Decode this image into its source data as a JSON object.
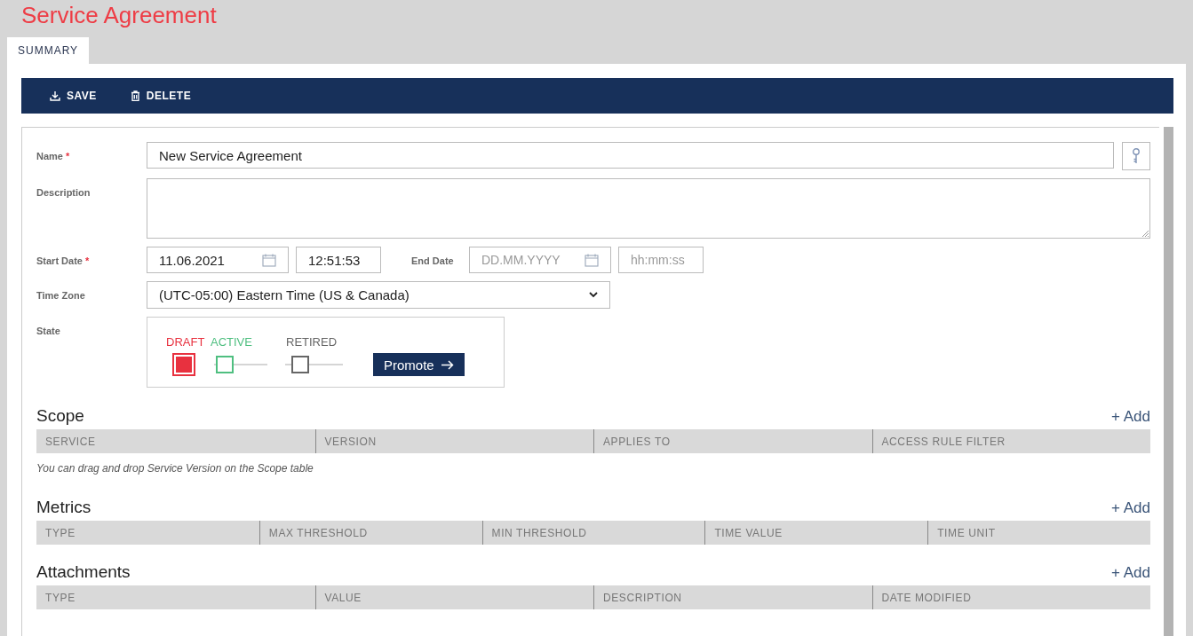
{
  "page_title": "Service Agreement",
  "tabs": [
    {
      "label": "SUMMARY",
      "selected": true
    }
  ],
  "toolbar": [
    {
      "kind": "save",
      "label": "SAVE"
    },
    {
      "kind": "delete",
      "label": "DELETE"
    }
  ],
  "form": {
    "name": {
      "label": "Name",
      "required_mark": "*",
      "value": "New Service Agreement"
    },
    "description": {
      "label": "Description"
    },
    "start": {
      "label": "Start Date",
      "required_mark": "*",
      "date": "11.06.2021",
      "time": "12:51:53"
    },
    "end": {
      "label": "End Date",
      "date_placeholder": "DD.MM.YYYY",
      "time_placeholder": "hh:mm:ss"
    },
    "time_zone": {
      "label": "Time Zone",
      "value": "(UTC-05:00) Eastern Time (US & Canada)"
    },
    "state": {
      "label": "State",
      "stages": [
        {
          "label": "DRAFT",
          "color": "#e8313f",
          "selected": true
        },
        {
          "label": "ACTIVE",
          "color": "#4fbf80",
          "selected": false
        },
        {
          "label": "RETIRED",
          "color": "#666666",
          "selected": false
        }
      ],
      "button": "Promote"
    }
  },
  "sections": [
    {
      "title": "Scope",
      "add": "+ Add",
      "columns": [
        "SERVICE",
        "VERSION",
        "APPLIES TO",
        "ACCESS RULE FILTER"
      ],
      "note": "You can drag and drop Service Version on the Scope table"
    },
    {
      "title": "Metrics",
      "add": "+ Add",
      "columns": [
        "TYPE",
        "MAX THRESHOLD",
        "MIN THRESHOLD",
        "TIME VALUE",
        "TIME UNIT"
      ]
    },
    {
      "title": "Attachments",
      "add": "+ Add",
      "columns": [
        "TYPE",
        "VALUE",
        "DESCRIPTION",
        "DATE MODIFIED"
      ]
    }
  ]
}
